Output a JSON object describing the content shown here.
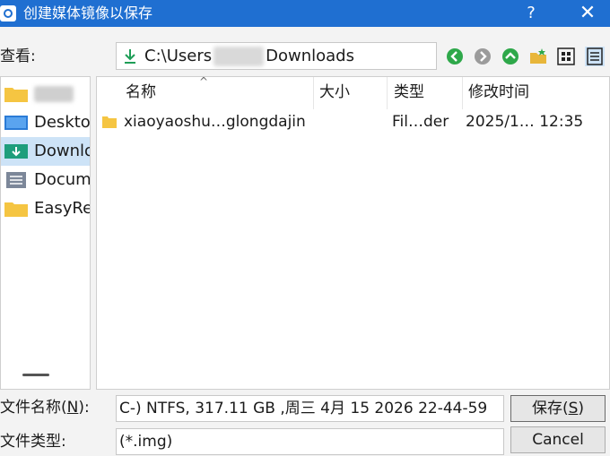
{
  "window": {
    "title": "创建媒体镜像以保存",
    "help": "?",
    "close": "✕"
  },
  "lookin": {
    "label": "查看:",
    "path_prefix": "C:\\Users",
    "path_suffix": "Downloads"
  },
  "sidebar": {
    "items": [
      {
        "label": ""
      },
      {
        "label": "Deskto"
      },
      {
        "label": "Downlo"
      },
      {
        "label": "Docum"
      },
      {
        "label": "EasyRe"
      }
    ]
  },
  "columns": {
    "name": "名称",
    "size": "大小",
    "type": "类型",
    "modified": "修改时间"
  },
  "files": [
    {
      "name": "xiaoyaoshu…glongdajin",
      "size": "",
      "type": "Fil…der",
      "modified": "2025/1…  12:35"
    }
  ],
  "filename": {
    "label_prefix": "文件名称(",
    "label_key": "N",
    "label_suffix": "):",
    "value": "C-) NTFS, 317.11 GB ,周三 4月 15 2026 22-44-59"
  },
  "filetype": {
    "label": "文件类型:",
    "value": "(*.img)"
  },
  "buttons": {
    "save_prefix": "保存(",
    "save_key": "S",
    "save_suffix": ")",
    "cancel": "Cancel"
  },
  "colors": {
    "titlebar": "#1f6fd1",
    "selection": "#cde3f7",
    "folder": "#f5c542"
  },
  "icons": [
    "back-icon",
    "forward-icon",
    "up-icon",
    "new-folder-icon",
    "view-tiles-icon",
    "view-details-icon"
  ]
}
